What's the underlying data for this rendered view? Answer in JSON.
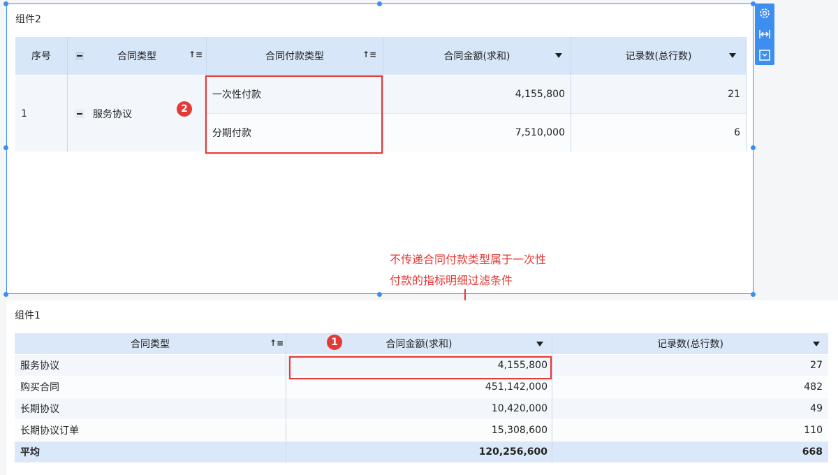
{
  "widget2": {
    "title": "组件2",
    "headers": {
      "index": "序号",
      "contract_type": "合同类型",
      "payment_type": "合同付款类型",
      "amount": "合同金额(求和)",
      "count": "记录数(总行数)"
    },
    "row": {
      "index": "1",
      "contract_type": "服务协议",
      "sub_rows": [
        {
          "payment_type": "一次性付款",
          "amount": "4,155,800",
          "count": "21"
        },
        {
          "payment_type": "分期付款",
          "amount": "7,510,000",
          "count": "6"
        }
      ]
    },
    "badge": "2"
  },
  "toolbar": {
    "icons": [
      "gear-icon",
      "fit-width-icon",
      "dropdown-menu-icon"
    ]
  },
  "annotation": {
    "line1": "不传递合同付款类型属于一次性",
    "line2": "付款的指标明细过滤条件"
  },
  "widget1": {
    "title": "组件1",
    "headers": {
      "contract_type": "合同类型",
      "amount": "合同金额(求和)",
      "count": "记录数(总行数)"
    },
    "rows": [
      {
        "contract_type": "服务协议",
        "amount": "4,155,800",
        "count": "27"
      },
      {
        "contract_type": "购买合同",
        "amount": "451,142,000",
        "count": "482"
      },
      {
        "contract_type": "长期协议",
        "amount": "10,420,000",
        "count": "49"
      },
      {
        "contract_type": "长期协议订单",
        "amount": "15,308,600",
        "count": "110"
      }
    ],
    "total": {
      "label": "平均",
      "amount": "120,256,600",
      "count": "668"
    },
    "badge": "1"
  },
  "colors": {
    "accent": "#3e8ef0",
    "header_bg": "#d7e6f8",
    "annotation_red": "#e53935"
  }
}
